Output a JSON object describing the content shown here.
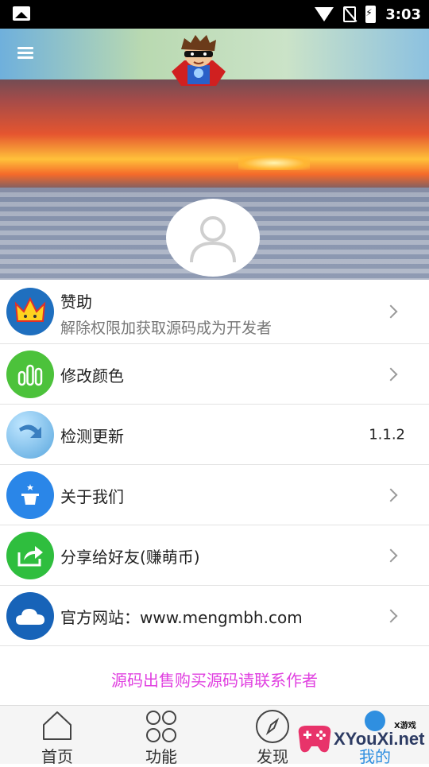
{
  "status_bar": {
    "time": "3:03"
  },
  "header": {
    "mascot_icon": "superhero-mascot-icon",
    "menu_icon": "menu-icon",
    "avatar_icon": "user-avatar-icon"
  },
  "list": [
    {
      "title": "赞助",
      "subtitle": "解除权限加获取源码成为开发者",
      "icon": "crown-icon",
      "icon_color": "#1f6fbf"
    },
    {
      "title": "修改颜色",
      "icon": "bar-chart-icon",
      "icon_color": "#4cc23b"
    },
    {
      "title": "检测更新",
      "value": "1.1.2",
      "icon": "update-arrow-icon",
      "icon_color": "#6fb8e8"
    },
    {
      "title": "关于我们",
      "icon": "magic-hat-icon",
      "icon_color": "#2a86e8"
    },
    {
      "title": "分享给好友(赚萌币)",
      "icon": "share-icon",
      "icon_color": "#2fbe3e"
    },
    {
      "title": "官方网站：www.mengmbh.com",
      "icon": "cloud-icon",
      "icon_color": "#1763b8"
    }
  ],
  "notice": "源码出售购买源码请联系作者",
  "bottom_nav": [
    {
      "label": "首页",
      "icon": "home-icon"
    },
    {
      "label": "功能",
      "icon": "grid-circles-icon"
    },
    {
      "label": "发现",
      "icon": "compass-icon"
    },
    {
      "label": "我的",
      "icon": "profile-icon",
      "active": true
    }
  ],
  "watermark": {
    "text": "XYouXi.net",
    "small": "X游戏"
  }
}
